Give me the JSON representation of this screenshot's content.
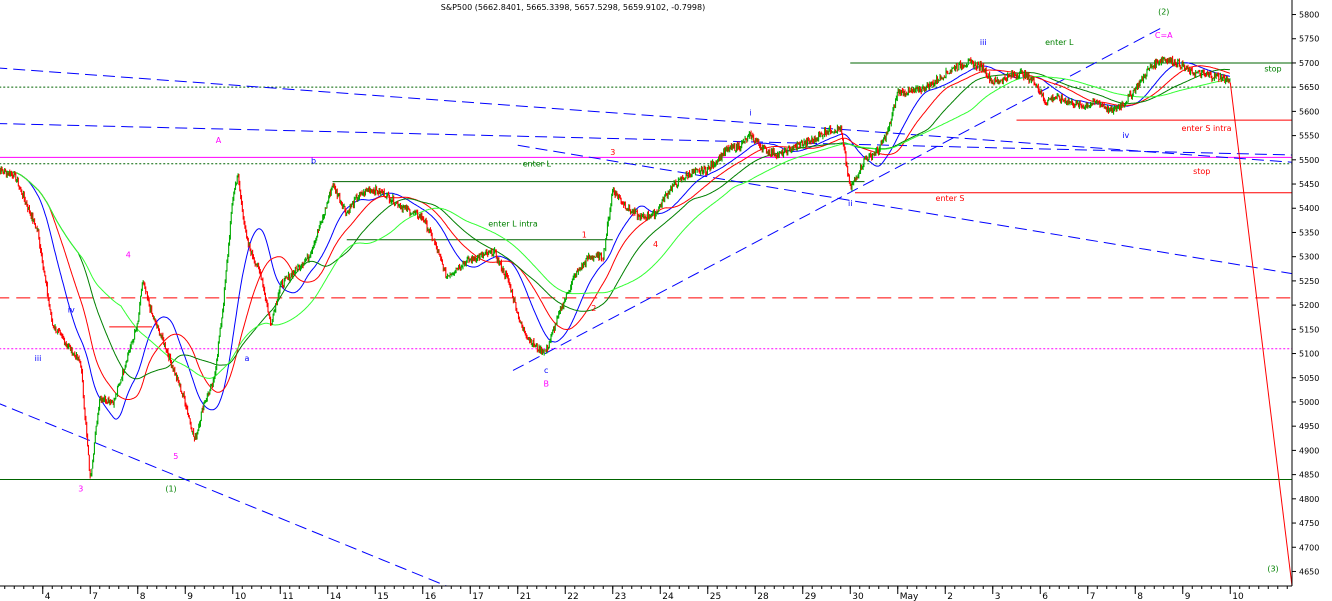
{
  "chart_data": {
    "type": "line",
    "title": "S&P500 (5662.8401, 5665.3398, 5657.5298, 5659.9102, -0.7998)",
    "ylim": [
      4620,
      5830
    ],
    "y_ticks": [
      4650,
      4700,
      4750,
      4800,
      4850,
      4900,
      4950,
      5000,
      5050,
      5100,
      5150,
      5200,
      5250,
      5300,
      5350,
      5400,
      5450,
      5500,
      5550,
      5600,
      5650,
      5700,
      5750,
      5800
    ],
    "x_labels": [
      "4",
      "7",
      "8",
      "9",
      "10",
      "11",
      "14",
      "15",
      "16",
      "17",
      "21",
      "22",
      "23",
      "24",
      "25",
      "28",
      "29",
      "30",
      "May",
      "2",
      "3",
      "6",
      "7",
      "8",
      "9",
      "10"
    ],
    "x_label_days": [
      1,
      2,
      3,
      4,
      5,
      6,
      7,
      8,
      9,
      10,
      11,
      12,
      13,
      14,
      15,
      16,
      17,
      18,
      19,
      20,
      21,
      22,
      23,
      24,
      25,
      26
    ],
    "xlim": [
      0.1,
      27.3
    ],
    "price_path": [
      [
        0.0,
        5480
      ],
      [
        0.4,
        5470
      ],
      [
        0.9,
        5350
      ],
      [
        1.2,
        5160
      ],
      [
        1.5,
        5120
      ],
      [
        1.8,
        5080
      ],
      [
        2.0,
        4840
      ],
      [
        2.2,
        5010
      ],
      [
        2.5,
        5000
      ],
      [
        2.8,
        5100
      ],
      [
        3.0,
        5160
      ],
      [
        3.1,
        5250
      ],
      [
        3.3,
        5180
      ],
      [
        3.6,
        5110
      ],
      [
        4.0,
        5000
      ],
      [
        4.2,
        4920
      ],
      [
        4.4,
        5000
      ],
      [
        4.6,
        5040
      ],
      [
        4.8,
        5200
      ],
      [
        5.0,
        5420
      ],
      [
        5.1,
        5470
      ],
      [
        5.3,
        5330
      ],
      [
        5.6,
        5260
      ],
      [
        5.8,
        5160
      ],
      [
        6.0,
        5240
      ],
      [
        6.3,
        5270
      ],
      [
        6.6,
        5300
      ],
      [
        6.9,
        5380
      ],
      [
        7.1,
        5450
      ],
      [
        7.4,
        5390
      ],
      [
        7.6,
        5420
      ],
      [
        7.9,
        5440
      ],
      [
        8.2,
        5430
      ],
      [
        8.6,
        5400
      ],
      [
        9.0,
        5380
      ],
      [
        9.2,
        5340
      ],
      [
        9.5,
        5260
      ],
      [
        9.9,
        5290
      ],
      [
        10.2,
        5300
      ],
      [
        10.5,
        5310
      ],
      [
        10.8,
        5250
      ],
      [
        11.1,
        5150
      ],
      [
        11.4,
        5110
      ],
      [
        11.6,
        5105
      ],
      [
        11.9,
        5190
      ],
      [
        12.2,
        5260
      ],
      [
        12.5,
        5300
      ],
      [
        12.8,
        5300
      ],
      [
        13.0,
        5440
      ],
      [
        13.3,
        5400
      ],
      [
        13.6,
        5380
      ],
      [
        13.9,
        5390
      ],
      [
        14.2,
        5440
      ],
      [
        14.6,
        5470
      ],
      [
        15.0,
        5480
      ],
      [
        15.4,
        5520
      ],
      [
        15.7,
        5530
      ],
      [
        15.9,
        5550
      ],
      [
        16.2,
        5520
      ],
      [
        16.5,
        5510
      ],
      [
        16.9,
        5530
      ],
      [
        17.2,
        5540
      ],
      [
        17.5,
        5560
      ],
      [
        17.8,
        5565
      ],
      [
        18.0,
        5440
      ],
      [
        18.3,
        5500
      ],
      [
        18.6,
        5520
      ],
      [
        18.8,
        5560
      ],
      [
        19.0,
        5640
      ],
      [
        19.3,
        5640
      ],
      [
        19.6,
        5650
      ],
      [
        19.9,
        5670
      ],
      [
        20.2,
        5690
      ],
      [
        20.5,
        5700
      ],
      [
        20.8,
        5690
      ],
      [
        21.0,
        5660
      ],
      [
        21.3,
        5670
      ],
      [
        21.6,
        5680
      ],
      [
        21.9,
        5660
      ],
      [
        22.1,
        5620
      ],
      [
        22.3,
        5630
      ],
      [
        22.6,
        5620
      ],
      [
        22.9,
        5610
      ],
      [
        23.2,
        5620
      ],
      [
        23.5,
        5600
      ],
      [
        23.8,
        5620
      ],
      [
        24.1,
        5660
      ],
      [
        24.3,
        5690
      ],
      [
        24.6,
        5710
      ],
      [
        24.9,
        5700
      ],
      [
        25.2,
        5680
      ],
      [
        25.5,
        5675
      ],
      [
        25.8,
        5670
      ],
      [
        26.0,
        5662
      ]
    ],
    "moving_averages": [
      {
        "color": "#0000ff",
        "period": 4
      },
      {
        "color": "#ff0000",
        "period": 7
      },
      {
        "color": "#008000",
        "period": 11
      },
      {
        "color": "#33ff33",
        "period": 17
      }
    ],
    "hlines": [
      {
        "y": 5505,
        "x1": 0.0,
        "x2": 27.3,
        "color": "#ff00ff",
        "dash": "solid"
      },
      {
        "y": 5492,
        "x1": 0.0,
        "x2": 27.3,
        "color": "#006400",
        "dash": "2,2"
      },
      {
        "y": 5650,
        "x1": 0.0,
        "x2": 27.3,
        "color": "#006400",
        "dash": "2,2"
      },
      {
        "y": 5110,
        "x1": 0.0,
        "x2": 27.3,
        "color": "#ff00ff",
        "dash": "2,2"
      },
      {
        "y": 5215,
        "x1": 0.0,
        "x2": 27.3,
        "color": "#ff0000",
        "dash": "14,7"
      },
      {
        "y": 4840,
        "x1": 0.0,
        "x2": 27.3,
        "color": "#006400",
        "dash": "solid"
      },
      {
        "y": 5700,
        "x1": 18.0,
        "x2": 27.3,
        "color": "#006400",
        "dash": "solid"
      },
      {
        "y": 5455,
        "x1": 7.1,
        "x2": 18.3,
        "color": "#006400",
        "dash": "solid"
      },
      {
        "y": 5335,
        "x1": 7.4,
        "x2": 13.0,
        "color": "#006400",
        "dash": "solid"
      },
      {
        "y": 5155,
        "x1": 2.4,
        "x2": 3.3,
        "color": "#ff0000",
        "dash": "solid"
      },
      {
        "y": 5582,
        "x1": 21.5,
        "x2": 27.3,
        "color": "#ff0000",
        "dash": "solid"
      },
      {
        "y": 5432,
        "x1": 18.1,
        "x2": 27.3,
        "color": "#ff0000",
        "dash": "solid"
      }
    ],
    "trendlines": [
      {
        "x1": 0.0,
        "y1": 5690,
        "x2": 27.3,
        "y2": 5495,
        "color": "#0000ff"
      },
      {
        "x1": 0.0,
        "y1": 5575,
        "x2": 27.3,
        "y2": 5510,
        "color": "#0000ff"
      },
      {
        "x1": 11.0,
        "y1": 5530,
        "x2": 27.3,
        "y2": 5265,
        "color": "#0000ff"
      },
      {
        "x1": 0.0,
        "y1": 5000,
        "x2": 9.5,
        "y2": 4620,
        "color": "#0000ff"
      },
      {
        "x1": 10.9,
        "y1": 5065,
        "x2": 24.6,
        "y2": 5775,
        "color": "#0000ff"
      },
      {
        "x1": 26.0,
        "y1": 5660,
        "x2": 27.3,
        "y2": 4620,
        "color": "#ff0000"
      }
    ],
    "annotations": [
      {
        "text": "(2)",
        "x": 24.6,
        "y": 5800,
        "color": "#008000"
      },
      {
        "text": "C=A",
        "x": 24.6,
        "y": 5752,
        "color": "#ff00ff"
      },
      {
        "text": "iii",
        "x": 20.8,
        "y": 5737,
        "color": "#0000ff"
      },
      {
        "text": "enter L",
        "x": 22.4,
        "y": 5737,
        "color": "#008000"
      },
      {
        "text": "stop",
        "x": 26.9,
        "y": 5682,
        "color": "#008000"
      },
      {
        "text": "i",
        "x": 15.9,
        "y": 5592,
        "color": "#0000ff"
      },
      {
        "text": "iv",
        "x": 23.8,
        "y": 5545,
        "color": "#0000ff"
      },
      {
        "text": "enter S intra",
        "x": 25.5,
        "y": 5560,
        "color": "#ff0000"
      },
      {
        "text": "A",
        "x": 4.7,
        "y": 5535,
        "color": "#ff00ff"
      },
      {
        "text": "b",
        "x": 6.7,
        "y": 5492,
        "color": "#0000ff"
      },
      {
        "text": "3",
        "x": 13.0,
        "y": 5510,
        "color": "#ff0000"
      },
      {
        "text": "enter L",
        "x": 11.4,
        "y": 5486,
        "color": "#008000"
      },
      {
        "text": "stop",
        "x": 25.4,
        "y": 5471,
        "color": "#ff0000"
      },
      {
        "text": "enter S",
        "x": 20.1,
        "y": 5415,
        "color": "#ff0000"
      },
      {
        "text": "ii",
        "x": 18.0,
        "y": 5405,
        "color": "#0000ff"
      },
      {
        "text": "enter L intra",
        "x": 10.9,
        "y": 5362,
        "color": "#008000"
      },
      {
        "text": "1",
        "x": 12.4,
        "y": 5340,
        "color": "#ff0000"
      },
      {
        "text": "4",
        "x": 13.9,
        "y": 5320,
        "color": "#ff0000"
      },
      {
        "text": "4",
        "x": 2.8,
        "y": 5298,
        "color": "#ff00ff"
      },
      {
        "text": "2",
        "x": 12.6,
        "y": 5188,
        "color": "#ff0000"
      },
      {
        "text": "iv",
        "x": 1.6,
        "y": 5185,
        "color": "#0000ff"
      },
      {
        "text": "a",
        "x": 5.3,
        "y": 5085,
        "color": "#0000ff"
      },
      {
        "text": "iii",
        "x": 0.9,
        "y": 5085,
        "color": "#0000ff"
      },
      {
        "text": "c",
        "x": 11.6,
        "y": 5060,
        "color": "#0000ff"
      },
      {
        "text": "B",
        "x": 11.6,
        "y": 5032,
        "color": "#ff00ff"
      },
      {
        "text": "5",
        "x": 3.8,
        "y": 4882,
        "color": "#ff00ff"
      },
      {
        "text": "3",
        "x": 1.8,
        "y": 4815,
        "color": "#ff00ff"
      },
      {
        "text": "(1)",
        "x": 3.7,
        "y": 4815,
        "color": "#008000"
      },
      {
        "text": "(3)",
        "x": 26.9,
        "y": 4650,
        "color": "#008000"
      }
    ]
  }
}
